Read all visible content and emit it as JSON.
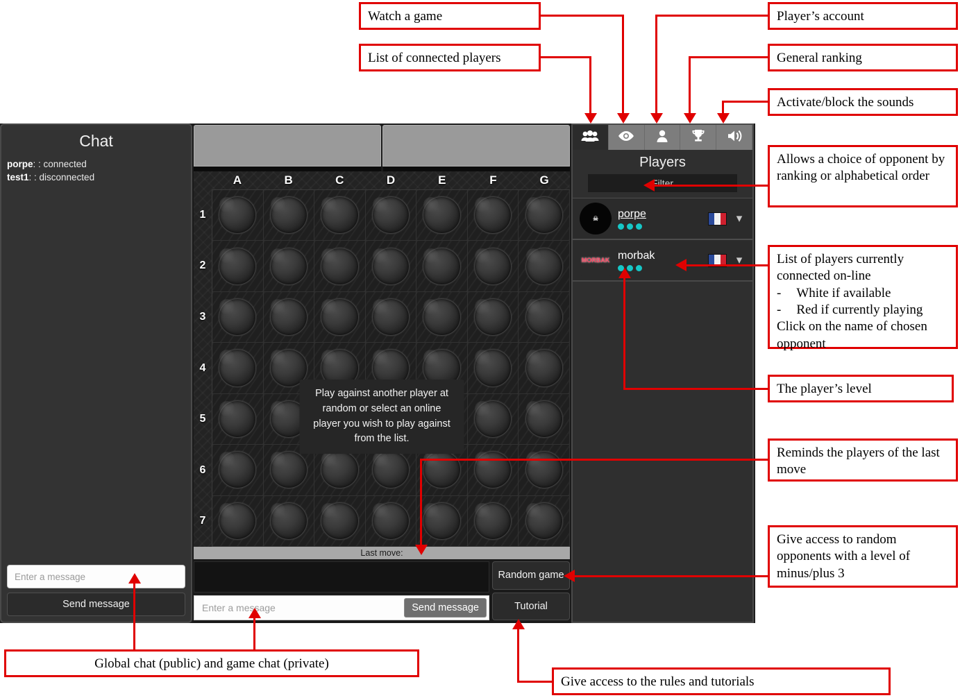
{
  "chat": {
    "title": "Chat",
    "messages": [
      {
        "user": "porpe",
        "text": ": : connected"
      },
      {
        "user": "test1",
        "text": ": : disconnected"
      }
    ],
    "input_placeholder": "Enter a message",
    "send_label": "Send message"
  },
  "game": {
    "columns": [
      "A",
      "B",
      "C",
      "D",
      "E",
      "F",
      "G"
    ],
    "rows": [
      "1",
      "2",
      "3",
      "4",
      "5",
      "6",
      "7"
    ],
    "tooltip": "Play against another player at random or select an online player you wish to play against from the list.",
    "last_move_label": "Last move:",
    "chat_placeholder": "Enter a message",
    "chat_send_label": "Send message",
    "random_game_label": "Random game",
    "tutorial_label": "Tutorial"
  },
  "players": {
    "title": "Players",
    "filter_placeholder": "Filter",
    "tabs": [
      {
        "icon": "people-icon",
        "active": true
      },
      {
        "icon": "eye-icon",
        "active": false
      },
      {
        "icon": "person-icon",
        "active": false
      },
      {
        "icon": "trophy-icon",
        "active": false
      },
      {
        "icon": "speaker-icon",
        "active": false
      }
    ],
    "list": [
      {
        "name": "porpe",
        "avatar": "porpe",
        "level_dots": 3,
        "flag": "FR",
        "underlined": true
      },
      {
        "name": "morbak",
        "avatar": "MORBAK",
        "level_dots": 3,
        "flag": "FR",
        "underlined": false
      }
    ]
  },
  "annotations": {
    "watch_game": "Watch a game",
    "connected_players": "List of connected players",
    "player_account": "Player’s account",
    "general_ranking": "General ranking",
    "sounds": "Activate/block the sounds",
    "filter_choice": "Allows a choice of opponent by ranking or alphabetical order",
    "player_list_l1": "List of players currently",
    "player_list_l2": "connected on-line",
    "player_list_l3": "White if available",
    "player_list_l4": "Red if currently playing",
    "player_list_l5": "Click on the name of chosen",
    "player_list_l6": "opponent",
    "player_level": "The player’s level",
    "last_move": "Reminds the players of the last move",
    "random_game": "Give access to random opponents with a level of minus/plus 3",
    "global_chat": "Global chat (public) and game chat (private)",
    "tutorial": "Give access to the rules and tutorials"
  },
  "colors": {
    "accent_red": "#e00000",
    "level_dot": "#16c7c7",
    "panel_bg": "#2f2f2f"
  }
}
